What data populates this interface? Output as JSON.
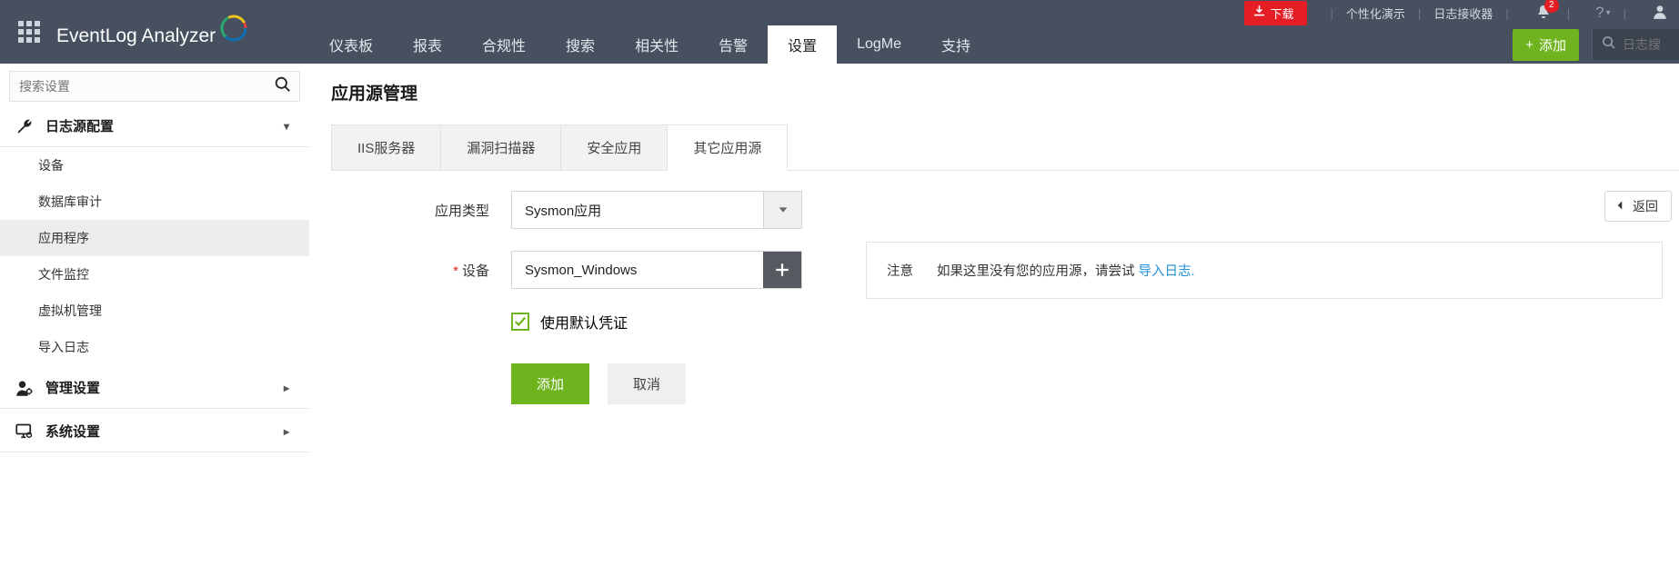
{
  "brand": {
    "name": "EventLog Analyzer"
  },
  "utilbar": {
    "download": "下载",
    "demo": "个性化演示",
    "receiver": "日志接收器",
    "notif_count": "2",
    "help": "?"
  },
  "nav": {
    "items": [
      "仪表板",
      "报表",
      "合规性",
      "搜索",
      "相关性",
      "告警",
      "设置",
      "LogMe",
      "支持"
    ],
    "active_index": 6,
    "add_label": "添加",
    "search_placeholder": "日志搜"
  },
  "sidebar": {
    "search_placeholder": "搜索设置",
    "sections": [
      {
        "title": "日志源配置",
        "expanded": true,
        "items": [
          "设备",
          "数据库审计",
          "应用程序",
          "文件监控",
          "虚拟机管理",
          "导入日志"
        ],
        "active_index": 2
      },
      {
        "title": "管理设置",
        "expanded": false
      },
      {
        "title": "系统设置",
        "expanded": false
      }
    ]
  },
  "page": {
    "title": "应用源管理",
    "tabs": [
      "IIS服务器",
      "漏洞扫描器",
      "安全应用",
      "其它应用源"
    ],
    "active_tab": 3,
    "back_label": "返回"
  },
  "form": {
    "app_type": {
      "label": "应用类型",
      "value": "Sysmon应用"
    },
    "device": {
      "label": "设备",
      "required": true,
      "value": "Sysmon_Windows"
    },
    "default_cred": {
      "label": "使用默认凭证",
      "checked": true
    },
    "add_btn": "添加",
    "cancel_btn": "取消"
  },
  "note": {
    "title": "注意",
    "text": "如果这里没有您的应用源，请尝试",
    "link": "导入日志."
  }
}
